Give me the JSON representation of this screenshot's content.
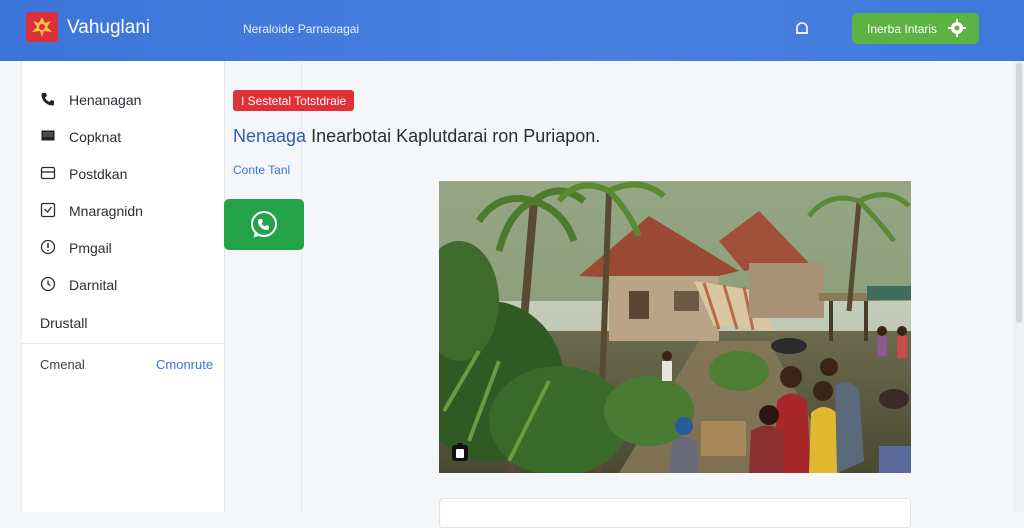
{
  "header": {
    "app_title": "Vahuglani",
    "subtitle": "Neraloide Parnaoagai",
    "action_button": "Inerba Intaris"
  },
  "sidebar": {
    "items": [
      {
        "label": "Henanagan",
        "icon": "phone-icon"
      },
      {
        "label": "Copknat",
        "icon": "monitor-icon"
      },
      {
        "label": "Postdkan",
        "icon": "card-icon"
      },
      {
        "label": "Mnaragnidn",
        "icon": "checkbox-icon"
      },
      {
        "label": "Pmgail",
        "icon": "alert-icon"
      },
      {
        "label": "Darnital",
        "icon": "clock-icon"
      }
    ],
    "section_title": "Drustall",
    "footer_left": "Cmenal",
    "footer_right": "Cmonrute"
  },
  "main": {
    "badge": "I Sestetal Totstdraie",
    "headline_accent": "Nenaaga",
    "headline_rest": "Inearbotai Kaplutdarai ron Puriapon.",
    "small_link": "Conte Tanl",
    "image_alt": "village-photo"
  },
  "colors": {
    "header_blue": "#3c74d8",
    "action_green": "#5db244",
    "badge_red": "#e23038",
    "button_green": "#24a24a"
  }
}
